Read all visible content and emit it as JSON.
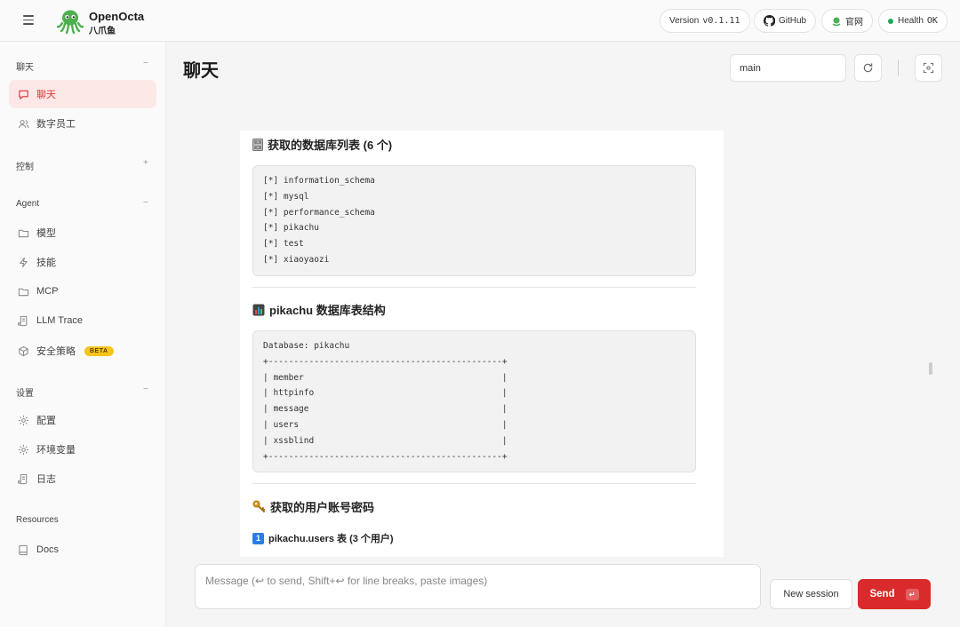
{
  "brand": {
    "name": "OpenOcta",
    "subtitle": "八爪鱼"
  },
  "header": {
    "version_label": "Version",
    "version_value": "v0.1.11",
    "github": "GitHub",
    "official": "官网",
    "health_label": "Health",
    "health_value": "OK"
  },
  "sidebar": {
    "sections": {
      "chat": "聊天",
      "control": "控制",
      "agent": "Agent",
      "settings": "设置",
      "resources": "Resources"
    },
    "toggles": {
      "chat": "−",
      "control": "+",
      "agent": "−",
      "settings": "−"
    },
    "items": {
      "chat": "聊天",
      "digital_staff": "数字员工",
      "models": "模型",
      "skills": "技能",
      "mcp": "MCP",
      "llm_trace": "LLM Trace",
      "security": "安全策略",
      "security_badge": "BETA",
      "config": "配置",
      "env": "环境变量",
      "logs": "日志",
      "docs": "Docs"
    }
  },
  "main": {
    "title": "聊天",
    "session": "main"
  },
  "message": {
    "db_heading": "获取的数据库列表 (6 个)",
    "db_list": [
      "[*] information_schema",
      "[*] mysql",
      "[*] performance_schema",
      "[*] pikachu",
      "[*] test",
      "[*] xiaoyaozi"
    ],
    "table_heading": "pikachu 数据库表结构",
    "table_lines": [
      "Database: pikachu",
      "+----------------------------------------------+",
      "| member                                       |",
      "| httpinfo                                     |",
      "| message                                      |",
      "| users                                        |",
      "| xssblind                                     |",
      "+----------------------------------------------+"
    ],
    "creds_heading": "获取的用户账号密码",
    "users_subheading": "pikachu.users 表 (3 个用户)",
    "users_number": "1"
  },
  "composer": {
    "placeholder": "Message (↩ to send, Shift+↩ for line breaks, paste images)",
    "new_session": "New session",
    "send": "Send",
    "send_key": "↵"
  },
  "colors": {
    "accent": "#d92b2b",
    "active_bg": "#fde8e8",
    "health_dot": "#22a55a",
    "logo": "#4caf50",
    "badge": "#f5c518"
  }
}
